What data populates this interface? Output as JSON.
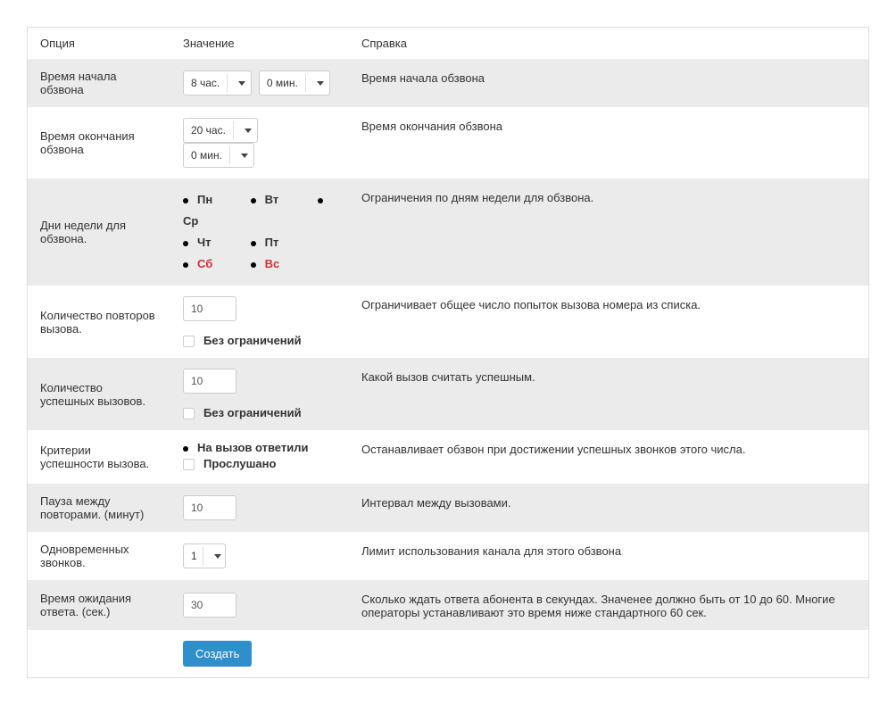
{
  "header": {
    "option": "Опция",
    "value": "Значение",
    "help": "Справка"
  },
  "rows": {
    "start": {
      "label": "Время начала обзвона",
      "hour": "8 час.",
      "min": "0 мин.",
      "help": "Время начала обзвона"
    },
    "end": {
      "label": "Время окончания обзвона",
      "hour": "20 час.",
      "min": "0 мин.",
      "help": "Время окончания обзвона"
    },
    "days": {
      "label": "Дни недели для обзвона.",
      "mon": "Пн",
      "tue": "Вт",
      "wed": "Ср",
      "thu": "Чт",
      "fri": "Пт",
      "sat": "Сб",
      "sun": "Вс",
      "help": "Ограничения по дням недели для обзвона."
    },
    "repeats": {
      "label": "Количество повторов вызова.",
      "value": "10",
      "unlimited": "Без ограничений",
      "help": "Ограничивает общее число попыток вызова номера из списка."
    },
    "success_count": {
      "label": "Количество успешных вызовов.",
      "value": "10",
      "unlimited": "Без ограничений",
      "help": "Какой вызов считать успешным."
    },
    "criteria": {
      "label": "Критерии успешности вызова.",
      "answered": "На вызов ответили",
      "listened": "Прослушано",
      "help": "Останавливает обзвон при достижении успешных звонков этого числа."
    },
    "pause": {
      "label": "Пауза между повторами. (минут)",
      "value": "10",
      "help": "Интервал между вызовами."
    },
    "concurrent": {
      "label": "Одновременных звонков.",
      "value": "1",
      "help": "Лимит использования канала для этого обзвона"
    },
    "wait": {
      "label": "Время ожидания ответа. (сек.)",
      "value": "30",
      "help": "Сколько ждать ответа абонента в секундах. Значенее должно быть от 10 до 60. Многие операторы устанавливают это время ниже стандартного 60 сек."
    }
  },
  "button": {
    "create": "Создать"
  }
}
